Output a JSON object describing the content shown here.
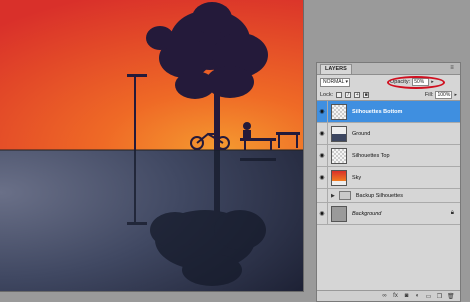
{
  "panel": {
    "tab_label": "LAYERS",
    "blend_mode": "NORMAL",
    "opacity_label": "Opacity:",
    "opacity_value": "50%",
    "lock_label": "Lock:",
    "fill_label": "Fill:",
    "fill_value": "100%",
    "layers": [
      {
        "name": "Silhouettes Bottom",
        "selected": true
      },
      {
        "name": "Ground",
        "selected": false
      },
      {
        "name": "Silhouettes Top",
        "selected": false
      },
      {
        "name": "Sky",
        "selected": false
      },
      {
        "name": "Backup Silhouettes",
        "group": true
      },
      {
        "name": "Background",
        "locked": true
      }
    ]
  },
  "icons": {
    "eye": "eye-icon",
    "lock": "lock-icon",
    "fx": "fx",
    "bottom_bar": [
      "link-icon",
      "fx-icon",
      "mask-icon",
      "adjustment-icon",
      "folder-icon",
      "new-layer-icon",
      "trash-icon"
    ]
  },
  "colors": {
    "selected_layer": "#3f8fe0",
    "highlight_ring": "#d01020",
    "sky_top": "#e84030",
    "sky_horizon": "#f07a20",
    "ground": "#3c4660",
    "silhouette": "#1e1830"
  }
}
